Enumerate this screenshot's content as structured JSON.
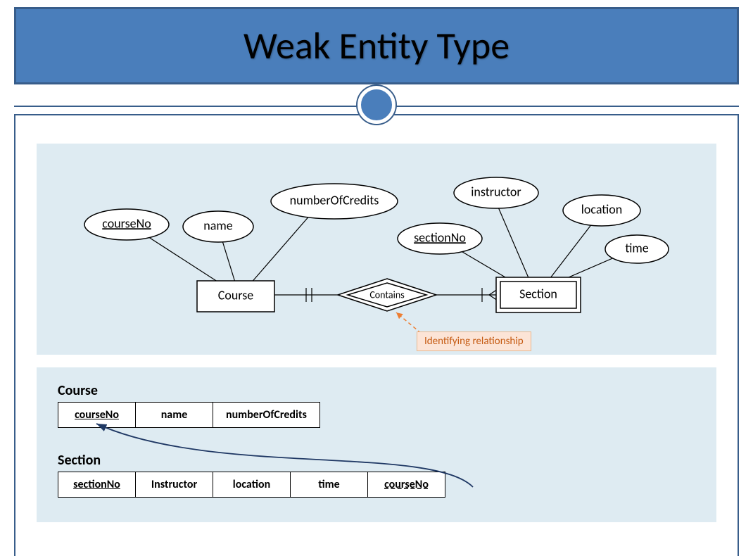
{
  "title": "Weak Entity Type",
  "er": {
    "entity1": {
      "name": "Course",
      "attrs": {
        "a1": "courseNo",
        "a2": "name",
        "a3": "numberOfCredits"
      }
    },
    "entity2": {
      "name": "Section",
      "attrs": {
        "b1": "sectionNo",
        "b2": "instructor",
        "b3": "location",
        "b4": "time"
      }
    },
    "rel": "Contains",
    "callout": "Identifying relationship"
  },
  "schema1": {
    "label": "Course",
    "cols": {
      "c1": "courseNo",
      "c2": "name",
      "c3": "numberOfCredits"
    }
  },
  "schema2": {
    "label": "Section",
    "cols": {
      "s1": "sectionNo",
      "s2": "Instructor",
      "s3": "location",
      "s4": "time",
      "s5": "courseNo"
    }
  }
}
